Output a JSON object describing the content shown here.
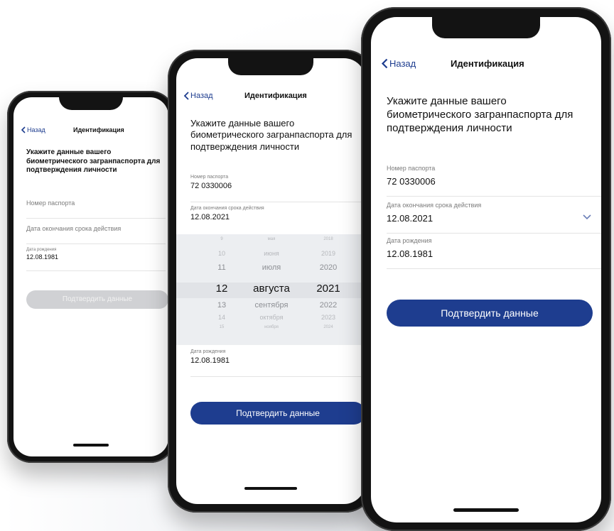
{
  "nav": {
    "back_label": "Назад",
    "title": "Идентификация"
  },
  "heading": "Укажите данные вашего биометрического загранпаспорта для подтверждения личности",
  "fields": {
    "passport_label": "Номер паспорта",
    "passport_value": "72 0330006",
    "expiry_label": "Дата окончания срока действия",
    "expiry_value": "12.08.2021",
    "birth_label": "Дата рождения",
    "birth_value": "12.08.1981"
  },
  "confirm_label": "Подтвердить данные",
  "picker": {
    "days": [
      "9",
      "10",
      "11",
      "12",
      "13",
      "14",
      "15"
    ],
    "months": [
      "мая",
      "июня",
      "июля",
      "августа",
      "сентября",
      "октября",
      "ноября"
    ],
    "years": [
      "2018",
      "2019",
      "2020",
      "2021",
      "2022",
      "2023",
      "2024"
    ],
    "selected_index": 3
  },
  "colors": {
    "accent": "#1e3d8f",
    "disabled": "#d0d1d4",
    "picker_bg": "#eceef1"
  }
}
